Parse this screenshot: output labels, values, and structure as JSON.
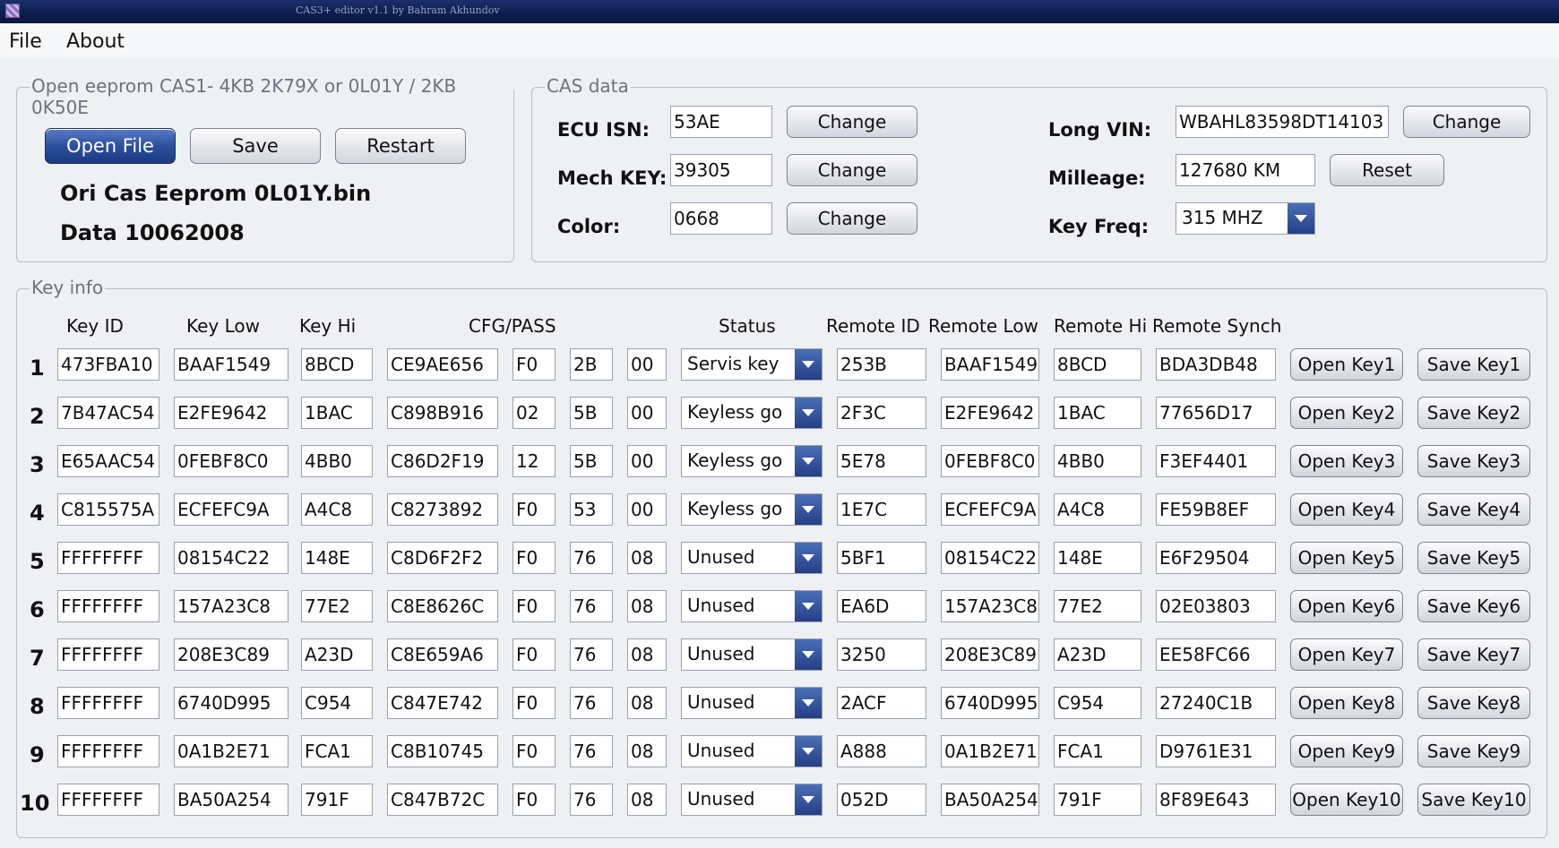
{
  "window": {
    "title": "CAS3+ editor v1.1 by Bahram Akhundov"
  },
  "menu": {
    "file": "File",
    "about": "About"
  },
  "eeprom": {
    "group_label": "Open eeprom CAS1- 4KB 2K79X or 0L01Y / 2KB 0K50E",
    "open_label": "Open File",
    "save_label": "Save",
    "restart_label": "Restart",
    "file_name": "Ori Cas Eeprom 0L01Y.bin",
    "data_info": "Data 10062008"
  },
  "cas": {
    "group_label": "CAS data",
    "ecu_isn_label": "ECU ISN:",
    "ecu_isn": "53AE",
    "mech_key_label": "Mech KEY:",
    "mech_key": "39305",
    "color_label": "Color:",
    "color": "0668",
    "change_label": "Change",
    "long_vin_label": "Long VIN:",
    "long_vin": "WBAHL83598DT14103",
    "milleage_label": "Milleage:",
    "milleage": "127680 KM",
    "reset_label": "Reset",
    "key_freq_label": "Key Freq:",
    "key_freq": "315 MHZ"
  },
  "keyinfo": {
    "group_label": "Key info",
    "headers": {
      "key_id": "Key ID",
      "key_low": "Key Low",
      "key_hi": "Key Hi",
      "cfg_pass": "CFG/PASS",
      "status": "Status",
      "remote_id": "Remote ID",
      "remote_low": "Remote Low",
      "remote_hi": "Remote Hi",
      "remote_synch": "Remote Synch"
    },
    "rows": [
      {
        "num": "1",
        "key_id": "473FBA10",
        "key_low": "BAAF1549",
        "key_hi": "8BCD",
        "cfg": "CE9AE656",
        "p1": "F0",
        "p2": "2B",
        "p3": "00",
        "status": "Servis key",
        "remote_id": "253B",
        "remote_low": "BAAF1549",
        "remote_hi": "8BCD",
        "remote_synch": "BDA3DB48",
        "open": "Open Key1",
        "save": "Save Key1"
      },
      {
        "num": "2",
        "key_id": "7B47AC54",
        "key_low": "E2FE9642",
        "key_hi": "1BAC",
        "cfg": "C898B916",
        "p1": "02",
        "p2": "5B",
        "p3": "00",
        "status": "Keyless go",
        "remote_id": "2F3C",
        "remote_low": "E2FE9642",
        "remote_hi": "1BAC",
        "remote_synch": "77656D17",
        "open": "Open Key2",
        "save": "Save Key2"
      },
      {
        "num": "3",
        "key_id": "E65AAC54",
        "key_low": "0FEBF8C0",
        "key_hi": "4BB0",
        "cfg": "C86D2F19",
        "p1": "12",
        "p2": "5B",
        "p3": "00",
        "status": "Keyless go",
        "remote_id": "5E78",
        "remote_low": "0FEBF8C0",
        "remote_hi": "4BB0",
        "remote_synch": "F3EF4401",
        "open": "Open Key3",
        "save": "Save Key3"
      },
      {
        "num": "4",
        "key_id": "C815575A",
        "key_low": "ECFEFC9A",
        "key_hi": "A4C8",
        "cfg": "C8273892",
        "p1": "F0",
        "p2": "53",
        "p3": "00",
        "status": "Keyless go",
        "remote_id": "1E7C",
        "remote_low": "ECFEFC9A",
        "remote_hi": "A4C8",
        "remote_synch": "FE59B8EF",
        "open": "Open Key4",
        "save": "Save Key4"
      },
      {
        "num": "5",
        "key_id": "FFFFFFFF",
        "key_low": "08154C22",
        "key_hi": "148E",
        "cfg": "C8D6F2F2",
        "p1": "F0",
        "p2": "76",
        "p3": "08",
        "status": "Unused",
        "remote_id": "5BF1",
        "remote_low": "08154C22",
        "remote_hi": "148E",
        "remote_synch": "E6F29504",
        "open": "Open Key5",
        "save": "Save Key5"
      },
      {
        "num": "6",
        "key_id": "FFFFFFFF",
        "key_low": "157A23C8",
        "key_hi": "77E2",
        "cfg": "C8E8626C",
        "p1": "F0",
        "p2": "76",
        "p3": "08",
        "status": "Unused",
        "remote_id": "EA6D",
        "remote_low": "157A23C8",
        "remote_hi": "77E2",
        "remote_synch": "02E03803",
        "open": "Open Key6",
        "save": "Save Key6"
      },
      {
        "num": "7",
        "key_id": "FFFFFFFF",
        "key_low": "208E3C89",
        "key_hi": "A23D",
        "cfg": "C8E659A6",
        "p1": "F0",
        "p2": "76",
        "p3": "08",
        "status": "Unused",
        "remote_id": "3250",
        "remote_low": "208E3C89",
        "remote_hi": "A23D",
        "remote_synch": "EE58FC66",
        "open": "Open Key7",
        "save": "Save Key7"
      },
      {
        "num": "8",
        "key_id": "FFFFFFFF",
        "key_low": "6740D995",
        "key_hi": "C954",
        "cfg": "C847E742",
        "p1": "F0",
        "p2": "76",
        "p3": "08",
        "status": "Unused",
        "remote_id": "2ACF",
        "remote_low": "6740D995",
        "remote_hi": "C954",
        "remote_synch": "27240C1B",
        "open": "Open Key8",
        "save": "Save Key8"
      },
      {
        "num": "9",
        "key_id": "FFFFFFFF",
        "key_low": "0A1B2E71",
        "key_hi": "FCA1",
        "cfg": "C8B10745",
        "p1": "F0",
        "p2": "76",
        "p3": "08",
        "status": "Unused",
        "remote_id": "A888",
        "remote_low": "0A1B2E71",
        "remote_hi": "FCA1",
        "remote_synch": "D9761E31",
        "open": "Open Key9",
        "save": "Save Key9"
      },
      {
        "num": "10",
        "key_id": "FFFFFFFF",
        "key_low": "BA50A254",
        "key_hi": "791F",
        "cfg": "C847B72C",
        "p1": "F0",
        "p2": "76",
        "p3": "08",
        "status": "Unused",
        "remote_id": "052D",
        "remote_low": "BA50A254",
        "remote_hi": "791F",
        "remote_synch": "8F89E643",
        "open": "Open Key10",
        "save": "Save Key10"
      }
    ]
  }
}
